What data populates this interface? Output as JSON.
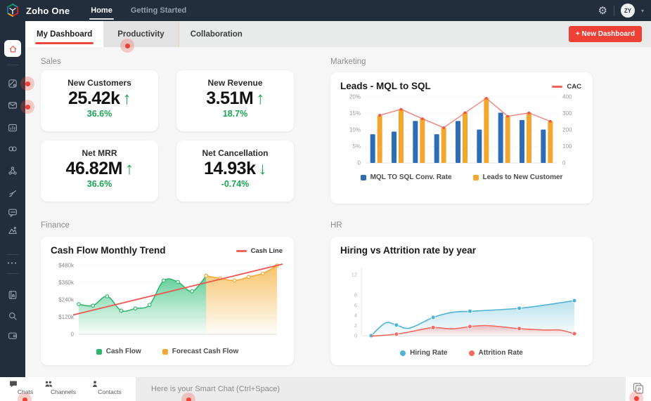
{
  "topbar": {
    "brand": "Zoho One",
    "nav": [
      {
        "label": "Home",
        "active": true
      },
      {
        "label": "Getting Started",
        "active": false
      }
    ],
    "avatar": "ZY"
  },
  "tabbar": {
    "tabs": [
      "My Dashboard",
      "Productivity",
      "Collaboration"
    ],
    "active_index": 0,
    "new_dashboard_label": "+ New Dashboard"
  },
  "sidebar": {
    "icons": [
      "home",
      "apps",
      "mail",
      "reports",
      "link",
      "share",
      "sign",
      "chat",
      "analytics",
      "more",
      "directory",
      "search",
      "wallet"
    ]
  },
  "sections": {
    "sales": {
      "title": "Sales",
      "cards": [
        {
          "label": "New Customers",
          "value": "25.42k",
          "direction": "up",
          "change": "36.6%"
        },
        {
          "label": "New Revenue",
          "value": "3.51M",
          "direction": "up",
          "change": "18.7%"
        },
        {
          "label": "Net MRR",
          "value": "46.82M",
          "direction": "up",
          "change": "36.6%"
        },
        {
          "label": "Net Cancellation",
          "value": "14.93k",
          "direction": "down",
          "change": "-0.74%"
        }
      ]
    },
    "marketing": {
      "title": "Marketing"
    },
    "finance": {
      "title": "Finance"
    },
    "hr": {
      "title": "HR"
    }
  },
  "bottombar": {
    "tabs": [
      "Chats",
      "Channels",
      "Contacts"
    ],
    "placeholder": "Here is your Smart Chat (Ctrl+Space)"
  },
  "colors": {
    "navy": "#232e3c",
    "accent_red": "#ef4136",
    "green": "#18a452",
    "bar_blue": "#2e6cb5",
    "bar_yellow": "#f3a72f",
    "line_red": "#f37b72",
    "fin_green": "#2db36d",
    "hr_blue": "#4fb3d6",
    "hr_red": "#f26a60"
  },
  "chart_data": [
    {
      "type": "bar",
      "title": "Leads - MQL to SQL",
      "overlay_legend": "CAC",
      "left_axis": {
        "max": 20,
        "ticks": [
          "20%",
          "15%",
          "10%",
          "5%",
          "0"
        ],
        "tick_values": [
          20,
          15,
          10,
          5,
          0
        ]
      },
      "right_axis": {
        "max": 400,
        "ticks": [
          "400",
          "300",
          "200",
          "100",
          "0"
        ],
        "tick_values": [
          400,
          300,
          200,
          100,
          0
        ]
      },
      "legend_position": "bottom",
      "series": [
        {
          "name": "MQL TO SQL Conv. Rate",
          "type": "bar",
          "axis": "left",
          "color": "#2e6cb5",
          "values": [
            8.7,
            9.5,
            12.7,
            8.7,
            12.7,
            10.1,
            15.2,
            13.0,
            10.1
          ]
        },
        {
          "name": "Leads to New Customer",
          "type": "bar",
          "axis": "right",
          "color": "#f3a72f",
          "values": [
            288,
            326,
            270,
            214,
            306,
            394,
            284,
            306,
            254
          ]
        },
        {
          "name": "CAC",
          "type": "line",
          "axis": "right",
          "color": "#f37b72",
          "values": [
            289,
            325,
            268,
            213,
            304,
            392,
            283,
            303,
            252
          ]
        }
      ]
    },
    {
      "type": "area",
      "title": "Cash Flow Monthly Trend",
      "overlay_legend": "Cash Line",
      "y_axis": {
        "max_k": 500,
        "ticks": [
          "$480k",
          "$360k",
          "$240k",
          "$120k",
          "0"
        ],
        "tick_values_k": [
          480,
          360,
          240,
          120,
          0
        ]
      },
      "x_slots": 15,
      "series": [
        {
          "name": "Cash Flow",
          "type": "area",
          "color": "#2db36d",
          "start_index": 0,
          "values_k": [
            210,
            200,
            265,
            165,
            180,
            205,
            375,
            365,
            300,
            408
          ]
        },
        {
          "name": "Forecast Cash Flow",
          "type": "area",
          "color": "#f3a72f",
          "start_index": 9,
          "values_k": [
            408,
            390,
            375,
            400,
            425,
            480
          ]
        },
        {
          "name": "Cash Line",
          "type": "trend",
          "color": "#ef5350",
          "from_k": 135,
          "to_k": 490
        }
      ]
    },
    {
      "type": "line",
      "title": "Hiring vs Attrition rate by year",
      "y_axis": {
        "max": 13,
        "ticks": [
          "12",
          "8",
          "6",
          "4",
          "2",
          "0"
        ],
        "tick_values": [
          12,
          8,
          6,
          4,
          2,
          0
        ]
      },
      "series": [
        {
          "name": "Hiring Rate",
          "color": "#4fb3d6",
          "marker_x": [
            0,
            0.124,
            0.305,
            0.486,
            0.729,
            1
          ],
          "marker_values": [
            0,
            2.1,
            3.6,
            4.8,
            5.4,
            6.9
          ],
          "curve": [
            [
              0,
              0
            ],
            [
              0.07,
              2.5
            ],
            [
              0.124,
              2.1
            ],
            [
              0.19,
              1.5
            ],
            [
              0.305,
              3.6
            ],
            [
              0.4,
              4.6
            ],
            [
              0.486,
              4.8
            ],
            [
              0.6,
              5.05
            ],
            [
              0.729,
              5.4
            ],
            [
              0.85,
              6.0
            ],
            [
              1,
              6.9
            ]
          ]
        },
        {
          "name": "Attrition Rate",
          "color": "#f26a60",
          "marker_x": [
            0.124,
            0.305,
            0.486,
            0.729,
            1
          ],
          "marker_values": [
            0.3,
            1.6,
            1.8,
            1.4,
            0.4
          ],
          "curve": [
            [
              0,
              -0.1
            ],
            [
              0.124,
              0.3
            ],
            [
              0.22,
              1.0
            ],
            [
              0.305,
              1.6
            ],
            [
              0.4,
              1.35
            ],
            [
              0.486,
              1.8
            ],
            [
              0.56,
              2.0
            ],
            [
              0.63,
              1.8
            ],
            [
              0.729,
              1.4
            ],
            [
              0.85,
              1.12
            ],
            [
              0.93,
              1.1
            ],
            [
              1,
              0.4
            ]
          ]
        }
      ]
    }
  ]
}
